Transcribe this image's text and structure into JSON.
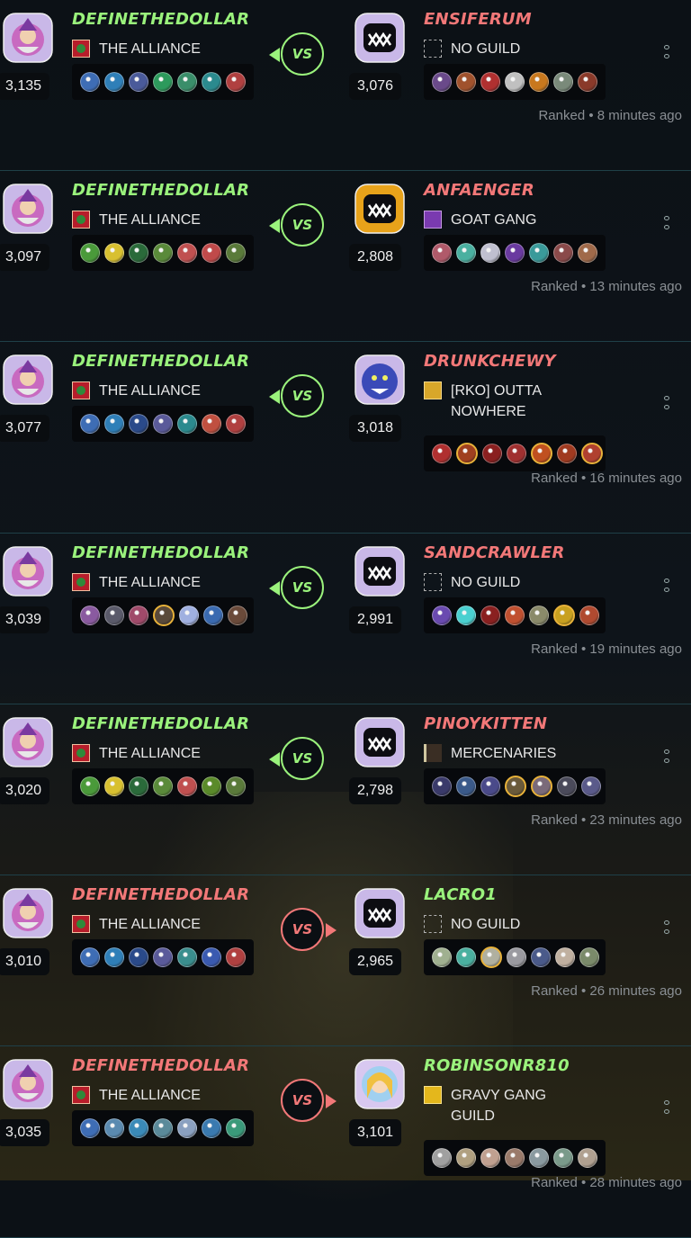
{
  "colors": {
    "win": "#9af27c",
    "loss": "#f27878",
    "divider": "#1f4048"
  },
  "battles": [
    {
      "player": {
        "name": "DEFINETHEDOLLAR",
        "result": "win",
        "rating": "3,135",
        "guild": "THE ALLIANCE",
        "guild_icon": "alliance",
        "avatar": "wizard",
        "team": [
          "#3e6db5",
          "#2f7fb8",
          "#4a5a9a",
          "#2d9a5c",
          "#3a8e6a",
          "#2b8a8e",
          "#b04040"
        ]
      },
      "opponent": {
        "name": "ENSIFERUM",
        "result": "loss",
        "rating": "3,076",
        "guild": "NO GUILD",
        "guild_icon": "none",
        "avatar": "monster-silver",
        "team": [
          "#6a4a8a",
          "#a0522d",
          "#b03030",
          "#c0c0c0",
          "#c8781e",
          "#7a8a7a",
          "#8a3a2a"
        ]
      },
      "vs": "VS",
      "mode": "Ranked",
      "time": "8 minutes ago"
    },
    {
      "player": {
        "name": "DEFINETHEDOLLAR",
        "result": "win",
        "rating": "3,097",
        "guild": "THE ALLIANCE",
        "guild_icon": "alliance",
        "avatar": "wizard",
        "team": [
          "#4a9a3a",
          "#d8c030",
          "#2a6a3a",
          "#5a8a3a",
          "#c05050",
          "#c04a4a",
          "#5a7a3a"
        ]
      },
      "opponent": {
        "name": "ANFAENGER",
        "result": "loss",
        "rating": "2,808",
        "guild": "GOAT GANG",
        "guild_icon": "goat",
        "avatar": "monster-gold",
        "team": [
          "#b05a6a",
          "#4ab0a0",
          "#c0c0d0",
          "#6a3aa0",
          "#3a9a9a",
          "#8a4a4a",
          "#a06a4a"
        ]
      },
      "vs": "VS",
      "mode": "Ranked",
      "time": "13 minutes ago"
    },
    {
      "player": {
        "name": "DEFINETHEDOLLAR",
        "result": "win",
        "rating": "3,077",
        "guild": "THE ALLIANCE",
        "guild_icon": "alliance",
        "avatar": "wizard",
        "team": [
          "#3e6db5",
          "#2f7fb8",
          "#2a4a8a",
          "#5a5a9a",
          "#2b8a8e",
          "#c05040",
          "#b04040"
        ]
      },
      "opponent": {
        "name": "DRUNKCHEWY",
        "result": "loss",
        "rating": "3,018",
        "guild": "[RKO] OUTTA NOWHERE",
        "guild_icon": "rko",
        "avatar": "blue-beast",
        "team": [
          "#b03030",
          "#a04020",
          "#8a2020",
          "#a03030",
          "#c05020",
          "#a03a20",
          "#b04030"
        ],
        "gold_slots": [
          1,
          4,
          6
        ]
      },
      "vs": "VS",
      "mode": "Ranked",
      "time": "16 minutes ago"
    },
    {
      "player": {
        "name": "DEFINETHEDOLLAR",
        "result": "win",
        "rating": "3,039",
        "guild": "THE ALLIANCE",
        "guild_icon": "alliance",
        "avatar": "wizard",
        "team": [
          "#8a5aa0",
          "#5a5a6a",
          "#a04a6a",
          "#5a4a3a",
          "#a0b0e0",
          "#3a6ab0",
          "#6a4a3a"
        ],
        "gold_slots": [
          3
        ]
      },
      "opponent": {
        "name": "SANDCRAWLER",
        "result": "loss",
        "rating": "2,991",
        "guild": "NO GUILD",
        "guild_icon": "none",
        "avatar": "monster-silver",
        "team": [
          "#6a4ab0",
          "#4ad0d0",
          "#8a2020",
          "#c05030",
          "#8a8a6a",
          "#c8a020",
          "#b04a30"
        ],
        "gold_slots": [
          5
        ]
      },
      "vs": "VS",
      "mode": "Ranked",
      "time": "19 minutes ago"
    },
    {
      "player": {
        "name": "DEFINETHEDOLLAR",
        "result": "win",
        "rating": "3,020",
        "guild": "THE ALLIANCE",
        "guild_icon": "alliance",
        "avatar": "wizard",
        "team": [
          "#4a9a3a",
          "#d8c030",
          "#2a6a3a",
          "#5a8a3a",
          "#c05050",
          "#5a8a2a",
          "#5a7a3a"
        ]
      },
      "opponent": {
        "name": "PINOYKITTEN",
        "result": "loss",
        "rating": "2,798",
        "guild": "MERCENARIES",
        "guild_icon": "merc",
        "avatar": "monster-silver",
        "team": [
          "#3a3a6a",
          "#3a5a8a",
          "#4a4a8a",
          "#6a5a3a",
          "#7a6a7a",
          "#4a4a5a",
          "#5a5a8a"
        ],
        "gold_slots": [
          3,
          4
        ]
      },
      "vs": "VS",
      "mode": "Ranked",
      "time": "23 minutes ago"
    },
    {
      "player": {
        "name": "DEFINETHEDOLLAR",
        "result": "loss",
        "rating": "3,010",
        "guild": "THE ALLIANCE",
        "guild_icon": "alliance",
        "avatar": "wizard",
        "team": [
          "#3e6db5",
          "#2f7fb8",
          "#2a4a8a",
          "#5a5a9a",
          "#3a8e8e",
          "#3a5ab0",
          "#b04040"
        ]
      },
      "opponent": {
        "name": "LACRO1",
        "result": "win",
        "rating": "2,965",
        "guild": "NO GUILD",
        "guild_icon": "none",
        "avatar": "monster-silver",
        "team": [
          "#a0b090",
          "#4ab0a0",
          "#b0b0a0",
          "#9a9aa0",
          "#4a5a8a",
          "#c0b0a0",
          "#7a8a6a"
        ],
        "gold_slots": [
          2
        ]
      },
      "vs": "VS",
      "mode": "Ranked",
      "time": "26 minutes ago"
    },
    {
      "player": {
        "name": "DEFINETHEDOLLAR",
        "result": "loss",
        "rating": "3,035",
        "guild": "THE ALLIANCE",
        "guild_icon": "alliance",
        "avatar": "wizard",
        "team": [
          "#3e6db5",
          "#5a8ab0",
          "#3a8ab8",
          "#5a8a9a",
          "#8aa0c0",
          "#3a7ab0",
          "#3a9a7a"
        ]
      },
      "opponent": {
        "name": "ROBINSONR810",
        "result": "win",
        "rating": "3,101",
        "guild": "GRAVY GANG GUILD",
        "guild_icon": "gravy",
        "avatar": "princess",
        "team": [
          "#a0a0a0",
          "#b0a080",
          "#c0a090",
          "#9a7a6a",
          "#8a9aa0",
          "#7a9a8a",
          "#b0a090"
        ]
      },
      "vs": "VS",
      "mode": "Ranked",
      "time": "28 minutes ago"
    }
  ]
}
